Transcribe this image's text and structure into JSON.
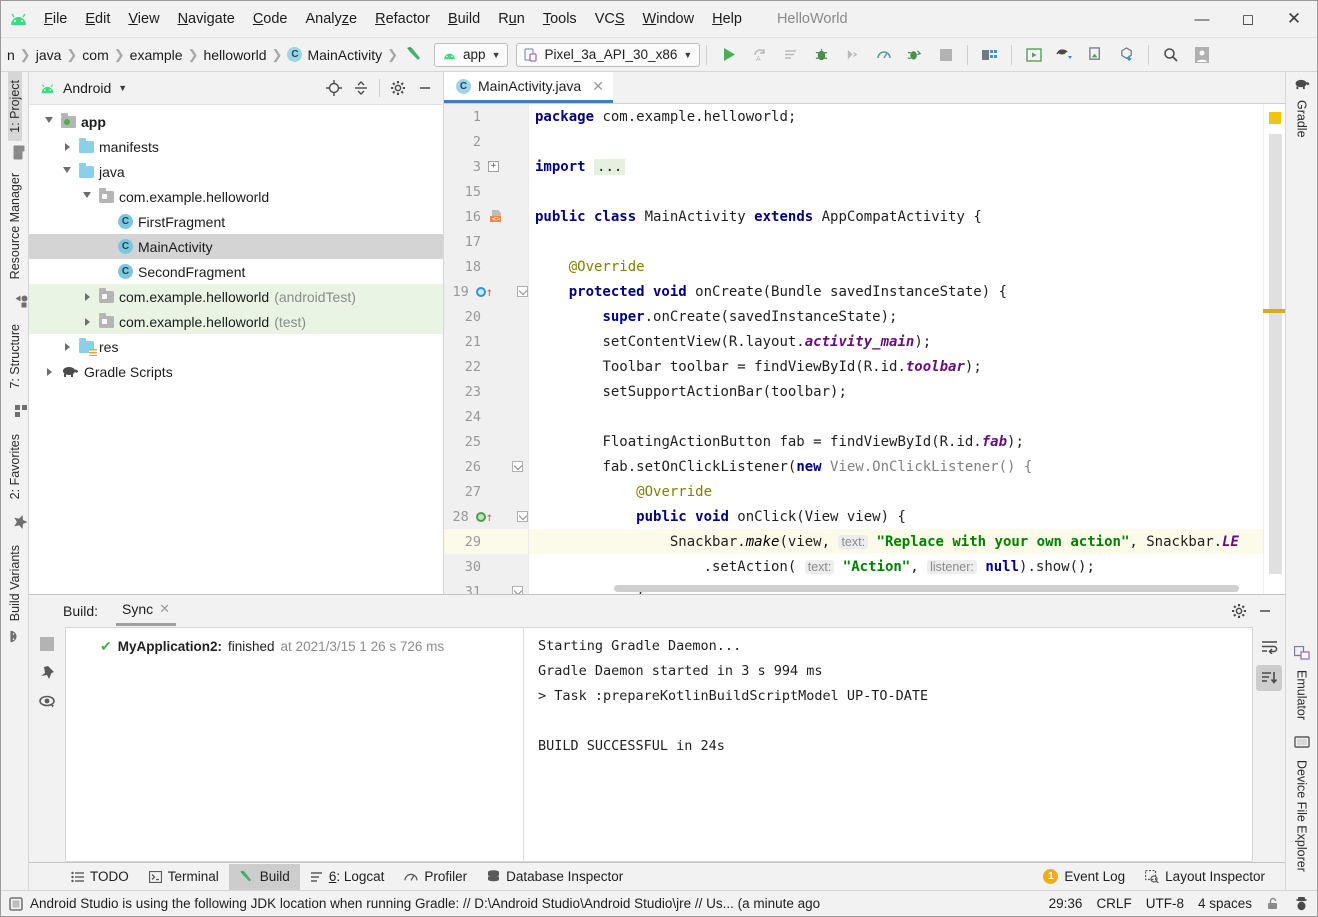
{
  "window": {
    "title": "HelloWorld",
    "minimize": "—",
    "maximize": "◻",
    "close": "✕"
  },
  "menu": [
    {
      "label": "File",
      "mnemonic": "F"
    },
    {
      "label": "Edit",
      "mnemonic": "E"
    },
    {
      "label": "View",
      "mnemonic": "V"
    },
    {
      "label": "Navigate",
      "mnemonic": "N"
    },
    {
      "label": "Code",
      "mnemonic": "C"
    },
    {
      "label": "Analyze",
      "mnemonic": "z"
    },
    {
      "label": "Refactor",
      "mnemonic": "R"
    },
    {
      "label": "Build",
      "mnemonic": "B"
    },
    {
      "label": "Run",
      "mnemonic": "u"
    },
    {
      "label": "Tools",
      "mnemonic": "T"
    },
    {
      "label": "VCS",
      "mnemonic": "S"
    },
    {
      "label": "Window",
      "mnemonic": "W"
    },
    {
      "label": "Help",
      "mnemonic": "H"
    }
  ],
  "navbar": {
    "breadcrumbs": [
      "n",
      "java",
      "com",
      "example",
      "helloworld",
      "MainActivity"
    ],
    "class_badge": "C",
    "module_combo": "app",
    "device_combo": "Pixel_3a_API_30_x86",
    "caret": "▼"
  },
  "project": {
    "title": "Android",
    "caret": "▼",
    "tree": [
      {
        "label": "app",
        "depth": 0,
        "twisty": "open",
        "icon": "module-folder",
        "bold": true,
        "selected": false,
        "test": false
      },
      {
        "label": "manifests",
        "depth": 1,
        "twisty": "closed",
        "icon": "folder",
        "bold": false,
        "selected": false,
        "test": false
      },
      {
        "label": "java",
        "depth": 1,
        "twisty": "open",
        "icon": "folder",
        "bold": false,
        "selected": false,
        "test": false
      },
      {
        "label": "com.example.helloworld",
        "depth": 2,
        "twisty": "open",
        "icon": "package",
        "bold": false,
        "selected": false,
        "test": false
      },
      {
        "label": "FirstFragment",
        "depth": 3,
        "twisty": "none",
        "icon": "class",
        "bold": false,
        "selected": false,
        "test": false
      },
      {
        "label": "MainActivity",
        "depth": 3,
        "twisty": "none",
        "icon": "class",
        "bold": false,
        "selected": true,
        "test": false
      },
      {
        "label": "SecondFragment",
        "depth": 3,
        "twisty": "none",
        "icon": "class",
        "bold": false,
        "selected": false,
        "test": false
      },
      {
        "label": "com.example.helloworld",
        "suffix": " (androidTest)",
        "depth": 2,
        "twisty": "closed",
        "icon": "package",
        "bold": false,
        "selected": false,
        "test": true
      },
      {
        "label": "com.example.helloworld",
        "suffix": " (test)",
        "depth": 2,
        "twisty": "closed",
        "icon": "package",
        "bold": false,
        "selected": false,
        "test": true
      },
      {
        "label": "res",
        "depth": 1,
        "twisty": "closed",
        "icon": "res-folder",
        "bold": false,
        "selected": false,
        "test": false
      },
      {
        "label": "Gradle Scripts",
        "depth": 0,
        "twisty": "closed",
        "icon": "gradle",
        "bold": false,
        "selected": false,
        "test": false
      }
    ]
  },
  "left_strip": [
    {
      "label": "1: Project",
      "mnemonic": "1",
      "selected": true
    },
    {
      "label": "Resource Manager",
      "mnemonic": "",
      "selected": false
    },
    {
      "label": "7: Structure",
      "mnemonic": "7",
      "selected": false
    },
    {
      "label": "2: Favorites",
      "mnemonic": "2",
      "selected": false
    },
    {
      "label": "Build Variants",
      "mnemonic": "",
      "selected": false
    }
  ],
  "right_strip": [
    {
      "label": "Gradle"
    },
    {
      "label": "Emulator"
    },
    {
      "label": "Device File Explorer"
    }
  ],
  "editor": {
    "tab": {
      "label": "MainActivity.java",
      "badge": "C",
      "close": "✕"
    },
    "lines": [
      {
        "num": "1",
        "marker": "",
        "fold": "",
        "highlight": false
      },
      {
        "num": "2",
        "marker": "",
        "fold": "",
        "highlight": false
      },
      {
        "num": "3",
        "marker": "",
        "fold": "plus",
        "highlight": false
      },
      {
        "num": "15",
        "marker": "",
        "fold": "",
        "highlight": false
      },
      {
        "num": "16",
        "marker": "bean",
        "fold": "",
        "highlight": false
      },
      {
        "num": "17",
        "marker": "",
        "fold": "",
        "highlight": false
      },
      {
        "num": "18",
        "marker": "",
        "fold": "",
        "highlight": false
      },
      {
        "num": "19",
        "marker": "override",
        "fold": "chev",
        "highlight": false
      },
      {
        "num": "20",
        "marker": "",
        "fold": "",
        "highlight": false
      },
      {
        "num": "21",
        "marker": "",
        "fold": "",
        "highlight": false
      },
      {
        "num": "22",
        "marker": "",
        "fold": "",
        "highlight": false
      },
      {
        "num": "23",
        "marker": "",
        "fold": "",
        "highlight": false
      },
      {
        "num": "24",
        "marker": "",
        "fold": "",
        "highlight": false
      },
      {
        "num": "25",
        "marker": "",
        "fold": "",
        "highlight": false
      },
      {
        "num": "26",
        "marker": "",
        "fold": "chev",
        "highlight": false
      },
      {
        "num": "27",
        "marker": "",
        "fold": "",
        "highlight": false
      },
      {
        "num": "28",
        "marker": "impl",
        "fold": "chev",
        "highlight": false
      },
      {
        "num": "29",
        "marker": "",
        "fold": "",
        "highlight": true
      },
      {
        "num": "30",
        "marker": "",
        "fold": "",
        "highlight": false
      },
      {
        "num": "31",
        "marker": "",
        "fold": "chev",
        "highlight": false
      }
    ],
    "code": {
      "l1_kw": "package",
      "l1_rest": " com.example.helloworld;",
      "l3_kw": "import",
      "l3_dots": "...",
      "l16_a": "public class",
      "l16_b": " MainActivity ",
      "l16_c": "extends",
      "l16_d": " AppCompatActivity {",
      "l18": "@Override",
      "l19_a": "protected void",
      "l19_b": " onCreate(Bundle savedInstanceState) {",
      "l20_a": "super",
      "l20_b": ".onCreate(savedInstanceState);",
      "l21_a": "setContentView(R.layout.",
      "l21_b": "activity_main",
      "l21_c": ");",
      "l22_a": "Toolbar toolbar = findViewById(R.id.",
      "l22_b": "toolbar",
      "l22_c": ");",
      "l23": "setSupportActionBar(toolbar);",
      "l25_a": "FloatingActionButton fab = findViewById(R.id.",
      "l25_b": "fab",
      "l25_c": ");",
      "l26_a": "fab.setOnClickListener(",
      "l26_b": "new",
      "l26_c": " View.OnClickListener() {",
      "l27": "@Override",
      "l28_a": "public void",
      "l28_b": " onClick(View view) {",
      "l29_a": "Snackbar.",
      "l29_b": "make",
      "l29_c": "(view, ",
      "l29_hint": "text:",
      "l29_str": "\"Replace with your own action\"",
      "l29_d": ", Snackbar.",
      "l29_e": "LE",
      "l30_a": ".setAction( ",
      "l30_hint1": "text:",
      "l30_str": "\"Action\"",
      "l30_b": ", ",
      "l30_hint2": "listener:",
      "l30_null": "null",
      "l30_c": ").show();",
      "l31": "}"
    }
  },
  "build_panel": {
    "label": "Build:",
    "tab": "Sync",
    "tab_close": "✕",
    "tree_row": {
      "check": "✔",
      "name": "MyApplication2:",
      "status": " finished",
      "time": " at 2021/3/15 1 26 s 726 ms"
    },
    "output": [
      "Starting Gradle Daemon...",
      "Gradle Daemon started in 3 s 994 ms",
      "> Task :prepareKotlinBuildScriptModel UP-TO-DATE",
      "",
      "BUILD SUCCESSFUL in 24s"
    ]
  },
  "bottom_tools": [
    {
      "label": "TODO",
      "icon": "list-icon",
      "mnemonic": "",
      "selected": false
    },
    {
      "label": "Terminal",
      "icon": "terminal-icon",
      "mnemonic": "",
      "selected": false
    },
    {
      "label": "Build",
      "icon": "hammer-icon",
      "mnemonic": "",
      "selected": true
    },
    {
      "label": "6: Logcat",
      "icon": "logcat-icon",
      "mnemonic": "6",
      "selected": false
    },
    {
      "label": "Profiler",
      "icon": "profiler-icon",
      "mnemonic": "",
      "selected": false
    },
    {
      "label": "Database Inspector",
      "icon": "database-icon",
      "mnemonic": "",
      "selected": false
    }
  ],
  "bottom_right_tools": [
    {
      "label": "Event Log",
      "badge": "1"
    },
    {
      "label": "Layout Inspector",
      "badge": ""
    }
  ],
  "status_bar": {
    "message": "Android Studio is using the following JDK location when running Gradle: // D:\\Android Studio\\Android Studio\\jre // Us... (a minute ago",
    "caret": "29:36",
    "line_sep": "CRLF",
    "encoding": "UTF-8",
    "indent": "4 spaces"
  },
  "colors": {
    "accent_blue": "#3d7cc9",
    "android_green": "#3ddc84",
    "keyword": "#000080",
    "string": "#008000",
    "annotation": "#808000",
    "field": "#660e7a",
    "selection": "#d4d4d4",
    "test_bg": "#e9f4e4",
    "current_line": "#fcfae8",
    "warning": "#f0ad18"
  }
}
